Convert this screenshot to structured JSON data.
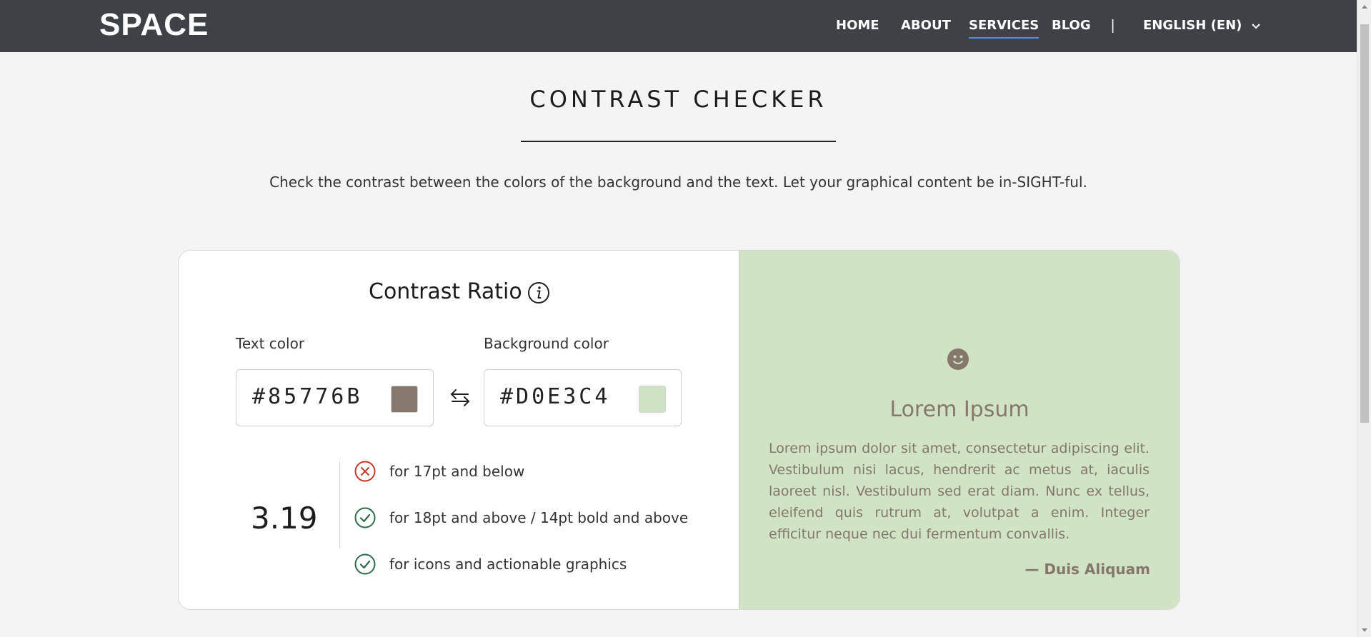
{
  "header": {
    "logo": "SPACE",
    "nav": [
      "HOME",
      "ABOUT",
      "SERVICES",
      "BLOG"
    ],
    "active_nav": "SERVICES",
    "separator": "|",
    "language": "ENGLISH (EN)"
  },
  "page": {
    "title": "CONTRAST CHECKER",
    "subtitle": "Check the contrast between the colors of the background and the text. Let your graphical content be in-SIGHT-ful."
  },
  "checker": {
    "heading": "Contrast Ratio",
    "text_color_label": "Text color",
    "background_color_label": "Background color",
    "text_color_value": "#85776B",
    "background_color_value": "#D0E3C4",
    "ratio": "3.19",
    "checks": [
      {
        "label": "for 17pt and below",
        "status": "fail"
      },
      {
        "label": "for 18pt and above / 14pt bold and above",
        "status": "pass"
      },
      {
        "label": "for icons and actionable graphics",
        "status": "pass"
      }
    ]
  },
  "preview": {
    "title": "Lorem Ipsum",
    "body": "Lorem ipsum dolor sit amet, consectetur adipiscing elit. Vestibulum nisi lacus, hendrerit ac metus at, iaculis laoreet nisl. Vestibulum sed erat diam. Nunc ex tellus, eleifend quis rutrum at, volutpat a enim. Integer efficitur neque nec dui fermentum convallis.",
    "author": "— Duis Aliquam"
  },
  "colors": {
    "header_bg": "#3e4146",
    "page_bg": "#f4f4f4",
    "accent": "#4c8ff5",
    "text_color": "#85776B",
    "background_color": "#D0E3C4",
    "fail": "#c0392b",
    "pass": "#2e6b4a"
  },
  "icons": {
    "info": "info-circle-icon",
    "swap": "swap-arrows-icon",
    "fail": "x-circle-icon",
    "pass": "check-circle-icon",
    "smiley": "smiley-icon",
    "dropdown": "chevron-down-icon"
  }
}
